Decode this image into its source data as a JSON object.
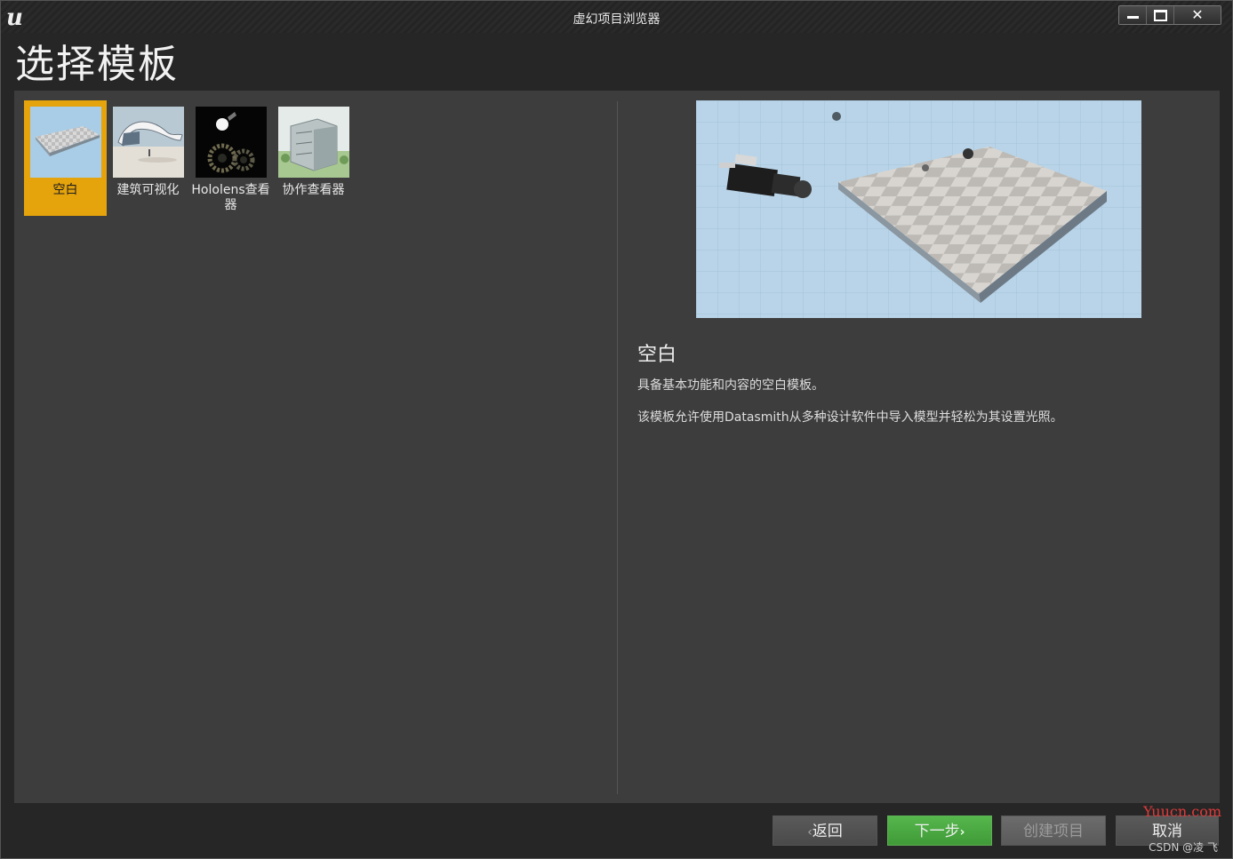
{
  "window": {
    "title": "虚幻项目浏览器",
    "logo": "ue-logo",
    "close_label": "✕"
  },
  "page": {
    "heading": "选择模板"
  },
  "templates": [
    {
      "label": "空白",
      "selected": true,
      "icon": "blank-checkerboard-thumbnail"
    },
    {
      "label": "建筑可视化",
      "selected": false,
      "icon": "architecture-thumbnail"
    },
    {
      "label": "Hololens查看器",
      "selected": false,
      "icon": "hololens-thumbnail"
    },
    {
      "label": "协作查看器",
      "selected": false,
      "icon": "collab-viewer-thumbnail"
    }
  ],
  "detail": {
    "title": "空白",
    "description_1": "具备基本功能和内容的空白模板。",
    "description_2": "该模板允许使用Datasmith从多种设计软件中导入模型并轻松为其设置光照。"
  },
  "footer": {
    "back_label": "返回",
    "back_chevron": "‹",
    "next_label": "下一步",
    "next_chevron": "›",
    "create_label": "创建项目",
    "cancel_label": "取消"
  },
  "watermark": {
    "site": "Yuucn.com",
    "author": "CSDN @凌 飞"
  },
  "colors": {
    "selected_tile": "#e5a30c",
    "next_button": "#4aa842",
    "panel": "#3d3d3d"
  }
}
